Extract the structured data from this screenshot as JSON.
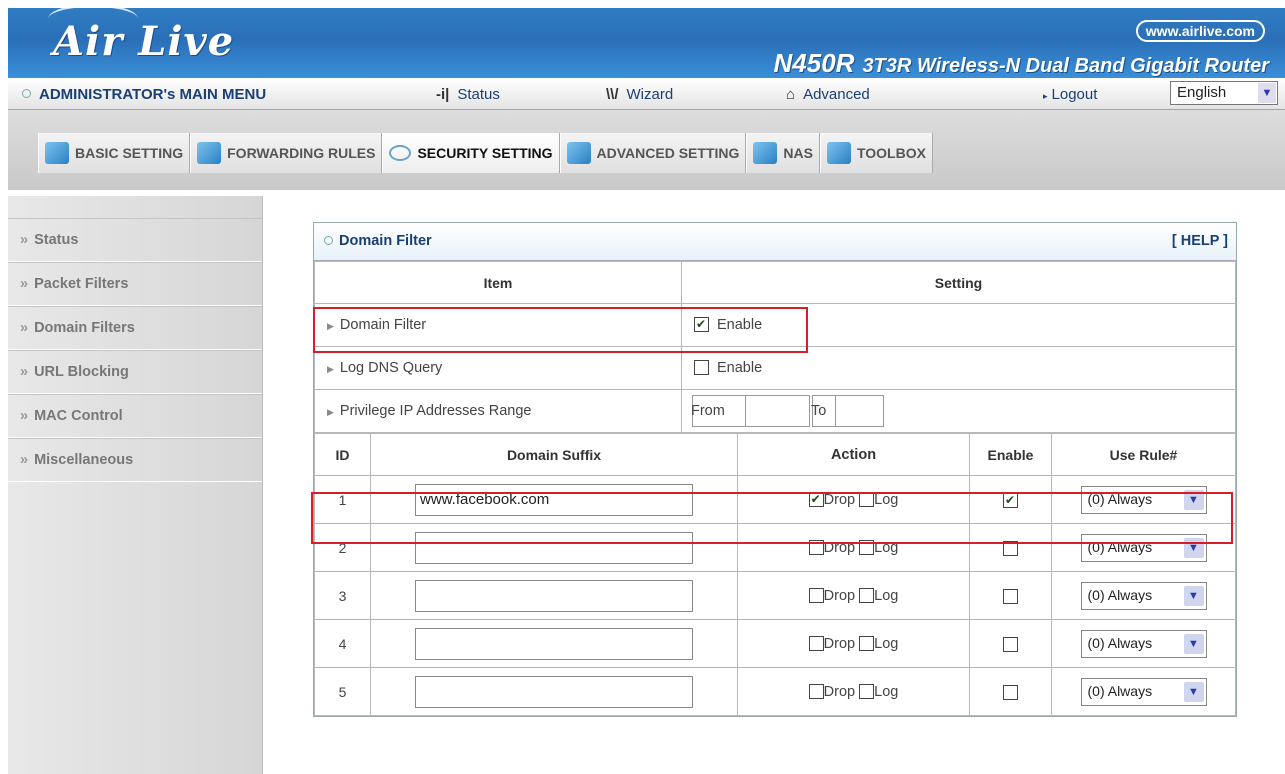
{
  "header": {
    "logo": "Air Live",
    "url": "www.airlive.com",
    "model": "N450R",
    "product_name": "3T3R Wireless-N Dual Band Gigabit Router"
  },
  "menubar": {
    "admin": "ADMINISTRATOR's MAIN MENU",
    "status": "Status",
    "wizard": "Wizard",
    "advanced": "Advanced",
    "logout": "Logout",
    "language": "English"
  },
  "tabs": [
    {
      "label": "BASIC SETTING"
    },
    {
      "label": "FORWARDING RULES"
    },
    {
      "label": "SECURITY SETTING"
    },
    {
      "label": "ADVANCED SETTING"
    },
    {
      "label": "NAS"
    },
    {
      "label": "TOOLBOX"
    }
  ],
  "sidebar": {
    "items": [
      {
        "label": "Status"
      },
      {
        "label": "Packet Filters"
      },
      {
        "label": "Domain Filters"
      },
      {
        "label": "URL Blocking"
      },
      {
        "label": "MAC Control"
      },
      {
        "label": "Miscellaneous"
      }
    ]
  },
  "panel": {
    "title": "Domain Filter",
    "help": "[ HELP ]",
    "col_item": "Item",
    "col_setting": "Setting",
    "domain_filter_label": "Domain Filter",
    "domain_filter_enable": "Enable",
    "log_dns_label": "Log DNS Query",
    "log_dns_enable": "Enable",
    "privilege_label": "Privilege IP Addresses Range",
    "from_label": "From",
    "to_label": "To"
  },
  "rules": {
    "col_id": "ID",
    "col_domain": "Domain Suffix",
    "col_action": "Action",
    "col_enable": "Enable",
    "col_rule": "Use Rule#",
    "drop": "Drop",
    "log": "Log",
    "rows": [
      {
        "id": "1",
        "domain": "www.facebook.com",
        "rule": "(0) Always"
      },
      {
        "id": "2",
        "domain": "",
        "rule": "(0) Always"
      },
      {
        "id": "3",
        "domain": "",
        "rule": "(0) Always"
      },
      {
        "id": "4",
        "domain": "",
        "rule": "(0) Always"
      },
      {
        "id": "5",
        "domain": "",
        "rule": "(0) Always"
      }
    ]
  },
  "colors": {
    "header_blue": "#2f7dc4",
    "highlight_red": "#d21f2a"
  }
}
